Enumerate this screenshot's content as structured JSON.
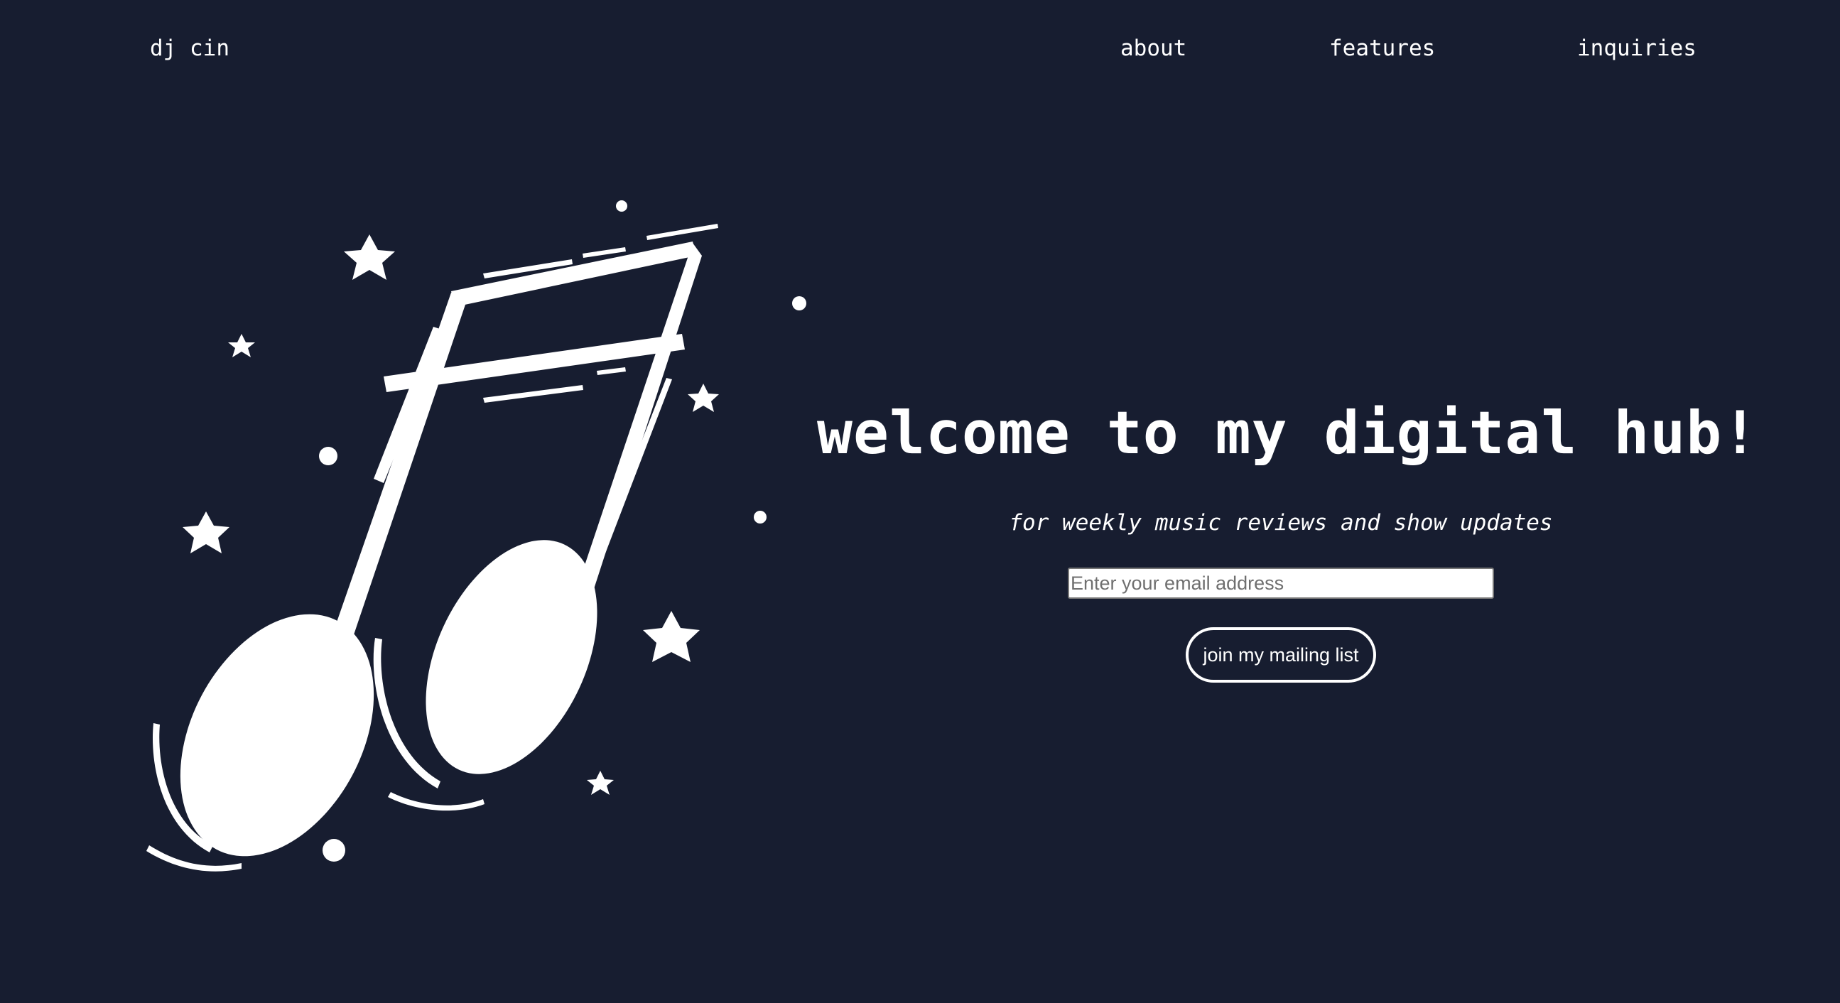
{
  "header": {
    "brand": "dj cin",
    "nav": [
      {
        "label": "about"
      },
      {
        "label": "features"
      },
      {
        "label": "inquiries"
      }
    ]
  },
  "hero": {
    "title": "welcome to my digital hub!",
    "subtitle": "for weekly music reviews and show updates",
    "email_placeholder": "Enter your email address",
    "email_value": "",
    "button_label": "join my mailing list"
  },
  "illustration": {
    "icon": "music-note-icon",
    "decorations": "star-icon"
  },
  "colors": {
    "background": "#171d30",
    "foreground": "#ffffff"
  }
}
